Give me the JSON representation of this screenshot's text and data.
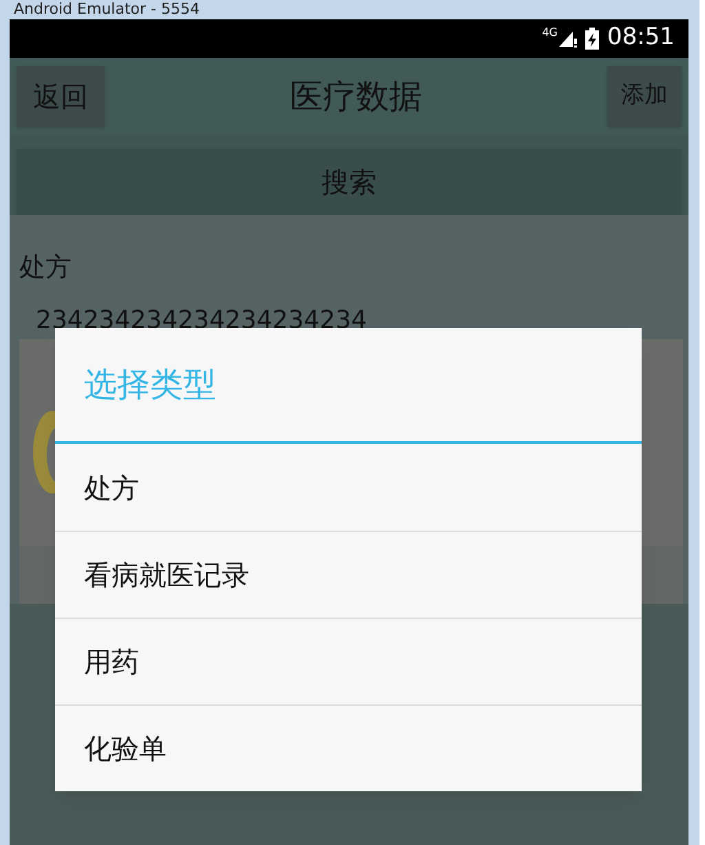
{
  "window": {
    "title": "Android Emulator - 5554"
  },
  "status_bar": {
    "time": "08:51",
    "network": "4G"
  },
  "app_bar": {
    "back": "返回",
    "title": "医疗数据",
    "add": "添加"
  },
  "search": {
    "label": "搜索"
  },
  "record": {
    "type": "处方",
    "value": "234234234234234234234"
  },
  "dialog": {
    "title": "选择类型",
    "items": [
      {
        "label": "处方"
      },
      {
        "label": "看病就医记录"
      },
      {
        "label": "用药"
      },
      {
        "label": "化验单"
      }
    ]
  }
}
